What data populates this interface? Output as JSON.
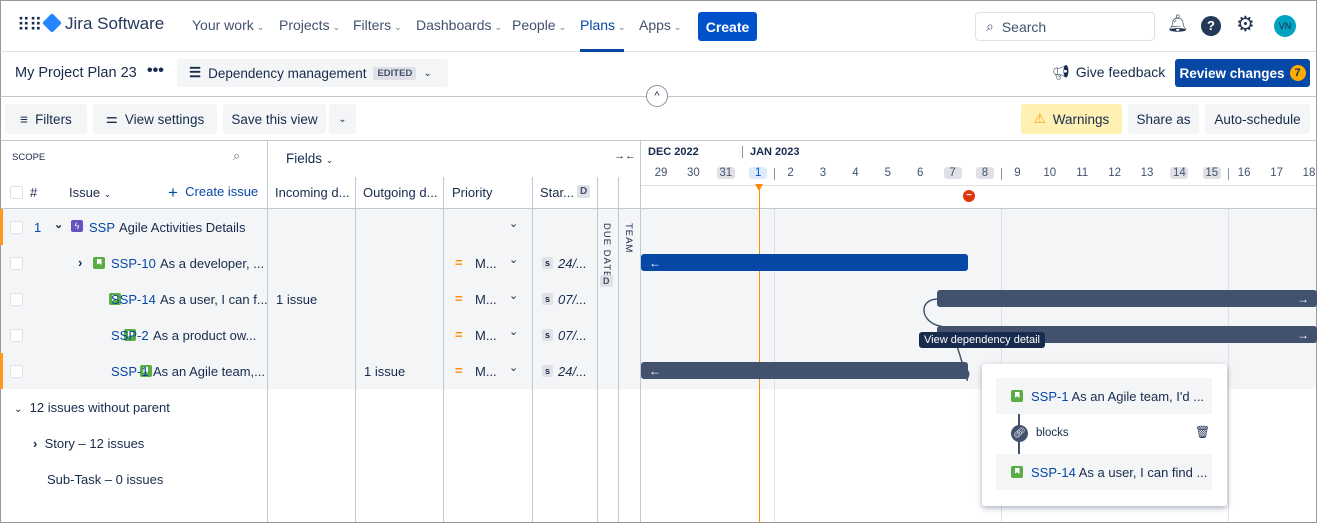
{
  "nav": {
    "product": "Jira Software",
    "items": [
      "Your work",
      "Projects",
      "Filters",
      "Dashboards",
      "People",
      "Plans",
      "Apps"
    ],
    "active": "Plans",
    "create": "Create",
    "search_placeholder": "Search",
    "avatar": "VN"
  },
  "plan": {
    "name": "My Project Plan 23",
    "view": "Dependency management",
    "edited": "EDITED",
    "feedback": "Give feedback",
    "review": "Review changes",
    "review_count": "7"
  },
  "toolbar": {
    "filters": "Filters",
    "view_settings": "View settings",
    "save_view": "Save this view",
    "warnings": "Warnings",
    "share": "Share as",
    "auto_schedule": "Auto-schedule"
  },
  "scope": {
    "label": "SCOPE",
    "fields": "Fields",
    "hash": "#",
    "issue": "Issue",
    "create_issue": "Create issue"
  },
  "columns": {
    "incoming": "Incoming d...",
    "outgoing": "Outgoing d...",
    "priority": "Priority",
    "start": "Star...",
    "d": "D",
    "due": "DUE DATE",
    "team": "TEAM"
  },
  "rows": [
    {
      "num": "1",
      "key": "SSP",
      "summary": "Agile Activities Details",
      "type": "epic",
      "incoming": "",
      "outgoing": "",
      "priority": "",
      "start": ""
    },
    {
      "num": "",
      "key": "SSP-10",
      "summary": "As a developer, ...",
      "type": "story",
      "incoming": "",
      "outgoing": "",
      "priority": "M...",
      "start": "24/..."
    },
    {
      "num": "",
      "key": "SSP-14",
      "summary": "As a user, I can f...",
      "type": "story",
      "incoming": "1 issue",
      "outgoing": "",
      "priority": "M...",
      "start": "07/..."
    },
    {
      "num": "",
      "key": "SSP-2",
      "summary": "As a product ow...",
      "type": "story",
      "incoming": "",
      "outgoing": "",
      "priority": "M...",
      "start": "07/..."
    },
    {
      "num": "",
      "key": "SSP-1",
      "summary": "As an Agile team,...",
      "type": "story",
      "incoming": "",
      "outgoing": "1 issue",
      "priority": "M...",
      "start": "24/..."
    }
  ],
  "groups": {
    "without_parent": "12 issues without parent",
    "story": "Story – 12 issues",
    "subtask": "Sub-Task – 0 issues"
  },
  "timeline": {
    "months": [
      "DEC 2022",
      "JAN 2023"
    ],
    "days": [
      {
        "d": "29"
      },
      {
        "d": "30"
      },
      {
        "d": "31",
        "we": true
      },
      {
        "d": "1",
        "today": true
      },
      {
        "d": "2"
      },
      {
        "d": "3"
      },
      {
        "d": "4"
      },
      {
        "d": "5"
      },
      {
        "d": "6"
      },
      {
        "d": "7",
        "we": true
      },
      {
        "d": "8",
        "we": true
      },
      {
        "d": "9"
      },
      {
        "d": "10"
      },
      {
        "d": "11"
      },
      {
        "d": "12"
      },
      {
        "d": "13"
      },
      {
        "d": "14",
        "we": true
      },
      {
        "d": "15",
        "we": true
      },
      {
        "d": "16"
      },
      {
        "d": "17"
      },
      {
        "d": "18"
      }
    ]
  },
  "tooltip": "View dependency detail",
  "dependency": {
    "from_key": "SSP-1",
    "from_summary": "As an Agile team, I'd ...",
    "relation": "blocks",
    "to_key": "SSP-14",
    "to_summary": "As a user, I can find ..."
  },
  "colors": {
    "brand": "#0052cc",
    "bar": "#42526e",
    "bar_selected": "#0747a6",
    "today": "#ff8b00",
    "warning_bg": "#fff0b3"
  }
}
